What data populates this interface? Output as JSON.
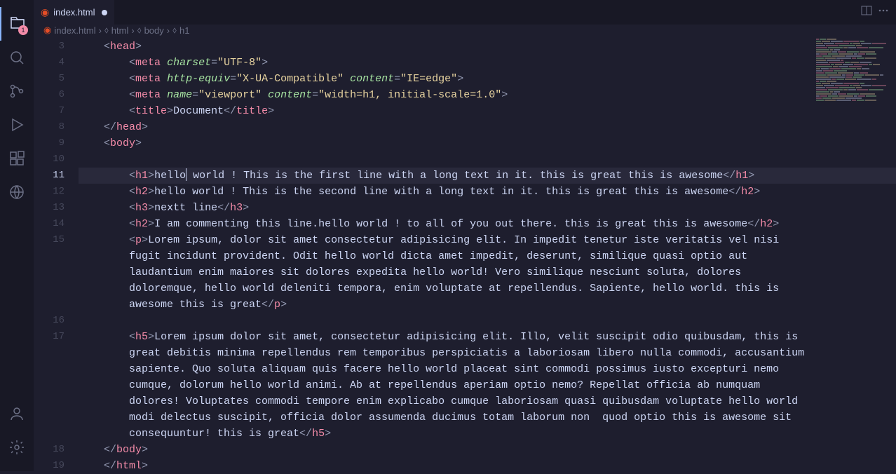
{
  "tab": {
    "filename": "index.html",
    "modified": true
  },
  "breadcrumbs": [
    {
      "icon": "html",
      "label": "index.html"
    },
    {
      "icon": "tag",
      "label": "html"
    },
    {
      "icon": "tag",
      "label": "body"
    },
    {
      "icon": "tag",
      "label": "h1"
    }
  ],
  "activity_badge": "1",
  "line_numbers": [
    "3",
    "4",
    "5",
    "6",
    "7",
    "8",
    "9",
    "10",
    "11",
    "12",
    "13",
    "14",
    "15",
    "16",
    "17",
    "18",
    "19"
  ],
  "active_line": "11",
  "code": {
    "l3": {
      "indent": "    ",
      "open_tag": "head"
    },
    "l4": {
      "indent": "        ",
      "tag": "meta",
      "attr1": "charset",
      "val1": "UTF-8"
    },
    "l5": {
      "indent": "        ",
      "tag": "meta",
      "attr1": "http-equiv",
      "val1": "X-UA-Compatible",
      "attr2": "content",
      "val2": "IE=edge"
    },
    "l6": {
      "indent": "        ",
      "tag": "meta",
      "attr1": "name",
      "val1": "viewport",
      "attr2": "content",
      "val2": "width=h1, initial-scale=1.0"
    },
    "l7": {
      "indent": "        ",
      "tag": "title",
      "text": "Document"
    },
    "l8": {
      "indent": "    ",
      "close_tag": "head"
    },
    "l9": {
      "indent": "    ",
      "open_tag": "body"
    },
    "l11": {
      "indent": "        ",
      "tag": "h1",
      "text": "hello world ! This is the first line with a long text in it. this is great this is awesome"
    },
    "l12": {
      "indent": "        ",
      "tag": "h2",
      "text": "hello world ! This is the second line with a long text in it. this is great this is awesome"
    },
    "l13": {
      "indent": "        ",
      "tag": "h3",
      "text": "nextt line"
    },
    "l14": {
      "indent": "        ",
      "tag": "h2",
      "text": "I am commenting this line.hello world ! to all of you out there. this is great this is awesome"
    },
    "l15": {
      "indent": "        ",
      "tag": "p",
      "text": "Lorem ipsum, dolor sit amet consectetur adipisicing elit. In impedit tenetur iste veritatis vel nisi fugit incidunt provident. Odit hello world dicta amet impedit, deserunt, similique quasi optio aut laudantium enim maiores sit dolores expedita hello world! Vero similique nesciunt soluta, dolores doloremque, hello world deleniti tempora, enim voluptate at repellendus. Sapiente, hello world. this is awesome this is great"
    },
    "l17": {
      "indent": "        ",
      "tag": "h5",
      "text": "Lorem ipsum dolor sit amet, consectetur adipisicing elit. Illo, velit suscipit odio quibusdam, this is great debitis minima repellendus rem temporibus perspiciatis a laboriosam libero nulla commodi, accusantium sapiente. Quo soluta aliquam quis facere hello world placeat sint commodi possimus iusto excepturi nemo cumque, dolorum hello world animi. Ab at repellendus aperiam optio nemo? Repellat officia ab numquam dolores! Voluptates commodi tempore enim explicabo cumque laboriosam quasi quibusdam voluptate hello world modi delectus suscipit, officia dolor assumenda ducimus totam laborum non  quod optio this is awesome sit consequuntur! this is great"
    },
    "l18": {
      "indent": "    ",
      "close_tag": "body"
    },
    "l19": {
      "indent": "    ",
      "close_tag": "html"
    }
  }
}
